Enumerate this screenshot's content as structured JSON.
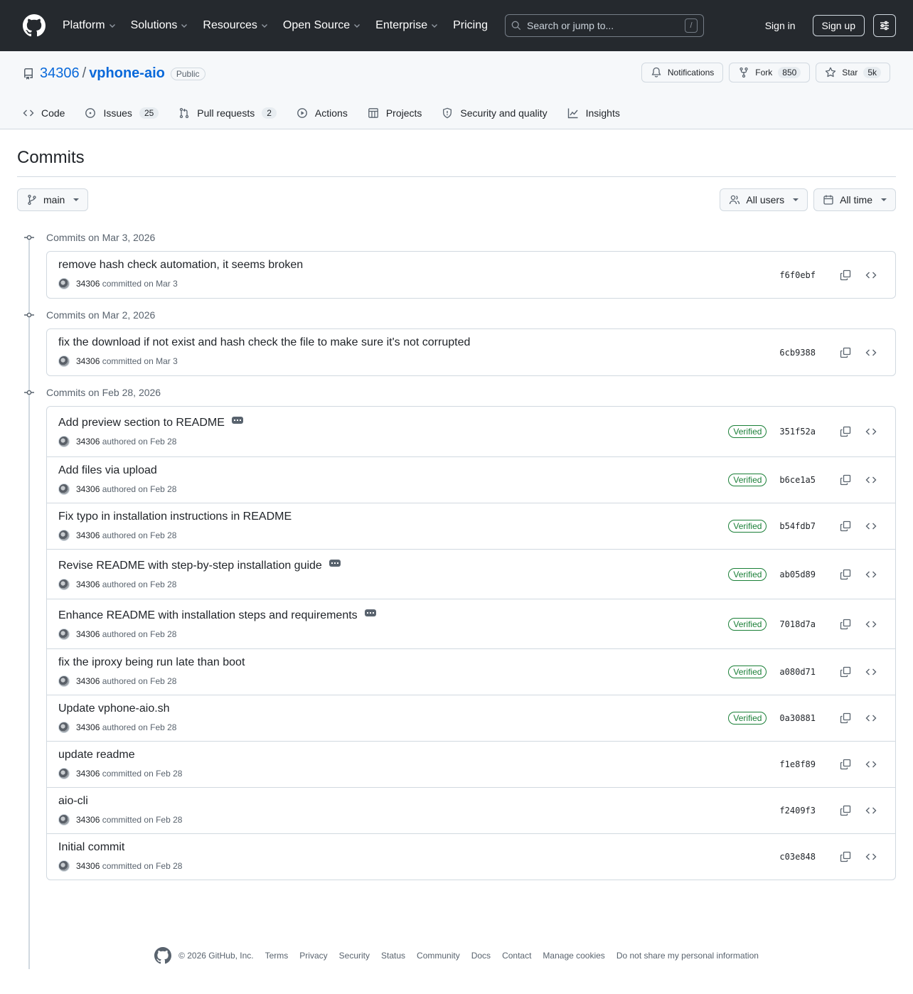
{
  "header": {
    "nav": [
      {
        "label": "Platform",
        "dropdown": true
      },
      {
        "label": "Solutions",
        "dropdown": true
      },
      {
        "label": "Resources",
        "dropdown": true
      },
      {
        "label": "Open Source",
        "dropdown": true
      },
      {
        "label": "Enterprise",
        "dropdown": true
      },
      {
        "label": "Pricing",
        "dropdown": false
      }
    ],
    "search_placeholder": "Search or jump to...",
    "search_shortcut": "/",
    "sign_in": "Sign in",
    "sign_up": "Sign up"
  },
  "repo": {
    "owner": "34306",
    "separator": "/",
    "name": "vphone-aio",
    "visibility": "Public",
    "notifications_label": "Notifications",
    "fork_label": "Fork",
    "fork_count": "850",
    "star_label": "Star",
    "star_count": "5k",
    "tabs": [
      {
        "label": "Code",
        "count": "",
        "icon": "code-icon"
      },
      {
        "label": "Issues",
        "count": "25",
        "icon": "issue-icon"
      },
      {
        "label": "Pull requests",
        "count": "2",
        "icon": "pull-request-icon"
      },
      {
        "label": "Actions",
        "count": "",
        "icon": "play-icon"
      },
      {
        "label": "Projects",
        "count": "",
        "icon": "table-icon"
      },
      {
        "label": "Security and quality",
        "count": "",
        "icon": "shield-icon"
      },
      {
        "label": "Insights",
        "count": "",
        "icon": "graph-icon"
      }
    ]
  },
  "page": {
    "title": "Commits",
    "branch": "main",
    "users_filter": "All users",
    "time_filter": "All time"
  },
  "groups": [
    {
      "heading": "Commits on Mar 3, 2026",
      "commits": [
        {
          "message": "remove hash check automation, it seems broken",
          "author": "34306",
          "action": "committed on Mar 3",
          "verified": false,
          "more": false,
          "sha": "f6f0ebf"
        }
      ]
    },
    {
      "heading": "Commits on Mar 2, 2026",
      "commits": [
        {
          "message": "fix the download if not exist and hash check the file to make sure it's not corrupted",
          "author": "34306",
          "action": "committed on Mar 3",
          "verified": false,
          "more": false,
          "sha": "6cb9388"
        }
      ]
    },
    {
      "heading": "Commits on Feb 28, 2026",
      "commits": [
        {
          "message": "Add preview section to README",
          "author": "34306",
          "action": "authored on Feb 28",
          "verified": true,
          "more": true,
          "sha": "351f52a"
        },
        {
          "message": "Add files via upload",
          "author": "34306",
          "action": "authored on Feb 28",
          "verified": true,
          "more": false,
          "sha": "b6ce1a5"
        },
        {
          "message": "Fix typo in installation instructions in README",
          "author": "34306",
          "action": "authored on Feb 28",
          "verified": true,
          "more": false,
          "sha": "b54fdb7"
        },
        {
          "message": "Revise README with step-by-step installation guide",
          "author": "34306",
          "action": "authored on Feb 28",
          "verified": true,
          "more": true,
          "sha": "ab05d89"
        },
        {
          "message": "Enhance README with installation steps and requirements",
          "author": "34306",
          "action": "authored on Feb 28",
          "verified": true,
          "more": true,
          "sha": "7018d7a"
        },
        {
          "message": "fix the iproxy being run late than boot",
          "author": "34306",
          "action": "authored on Feb 28",
          "verified": true,
          "more": false,
          "sha": "a080d71"
        },
        {
          "message": "Update vphone-aio.sh",
          "author": "34306",
          "action": "authored on Feb 28",
          "verified": true,
          "more": false,
          "sha": "0a30881"
        },
        {
          "message": "update readme",
          "author": "34306",
          "action": "committed on Feb 28",
          "verified": false,
          "more": false,
          "sha": "f1e8f89"
        },
        {
          "message": "aio-cli",
          "author": "34306",
          "action": "committed on Feb 28",
          "verified": false,
          "more": false,
          "sha": "f2409f3"
        },
        {
          "message": "Initial commit",
          "author": "34306",
          "action": "committed on Feb 28",
          "verified": false,
          "more": false,
          "sha": "c03e848"
        }
      ]
    }
  ],
  "verified_label": "Verified",
  "footer": {
    "copyright": "© 2026 GitHub, Inc.",
    "links": [
      "Terms",
      "Privacy",
      "Security",
      "Status",
      "Community",
      "Docs",
      "Contact",
      "Manage cookies",
      "Do not share my personal information"
    ]
  }
}
